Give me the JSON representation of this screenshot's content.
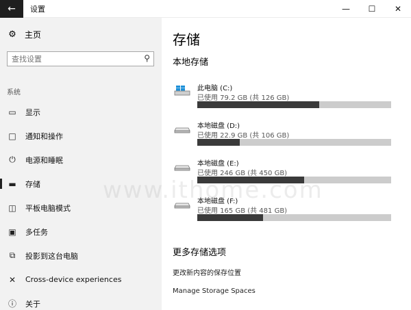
{
  "window": {
    "title": "设置",
    "back_icon": "arrow-left-icon",
    "minimize_icon": "minimize-icon",
    "maximize_icon": "maximize-icon",
    "close_icon": "close-icon"
  },
  "sidebar": {
    "home_label": "主页",
    "search_placeholder": "查找设置",
    "section_label": "系统",
    "items": [
      {
        "label": "显示",
        "icon": "monitor-icon",
        "active": false
      },
      {
        "label": "通知和操作",
        "icon": "notification-icon",
        "active": false
      },
      {
        "label": "电源和睡眠",
        "icon": "power-icon",
        "active": false
      },
      {
        "label": "存储",
        "icon": "storage-icon",
        "active": true
      },
      {
        "label": "平板电脑模式",
        "icon": "tablet-icon",
        "active": false
      },
      {
        "label": "多任务",
        "icon": "multitask-icon",
        "active": false
      },
      {
        "label": "投影到这台电脑",
        "icon": "project-icon",
        "active": false
      },
      {
        "label": "Cross-device experiences",
        "icon": "cross-device-icon",
        "active": false
      },
      {
        "label": "关于",
        "icon": "info-icon",
        "active": false
      }
    ]
  },
  "main": {
    "title": "存储",
    "local_storage_title": "本地存储",
    "drives": [
      {
        "name": "此电脑 (C:)",
        "usage": "已使用 79.2 GB (共 126 GB)",
        "used_fraction": 0.63,
        "icon": "windows-drive-icon"
      },
      {
        "name": "本地磁盘 (D:)",
        "usage": "已使用 22.9 GB (共 106 GB)",
        "used_fraction": 0.22,
        "icon": "drive-icon"
      },
      {
        "name": "本地磁盘 (E:)",
        "usage": "已使用 246 GB (共 450 GB)",
        "used_fraction": 0.55,
        "icon": "drive-icon"
      },
      {
        "name": "本地磁盘 (F:)",
        "usage": "已使用 165 GB (共 481 GB)",
        "used_fraction": 0.34,
        "icon": "drive-icon"
      }
    ],
    "more_options_title": "更多存储选项",
    "links": [
      "更改新内容的保存位置",
      "Manage Storage Spaces"
    ]
  },
  "watermark": "www.ithome.com"
}
